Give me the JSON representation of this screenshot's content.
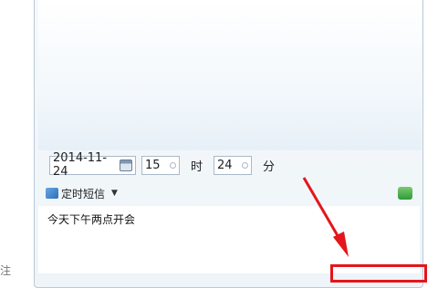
{
  "schedule": {
    "date": "2014-11-24",
    "hour": "15",
    "hour_unit": "时",
    "minute": "24",
    "minute_unit": "分"
  },
  "toolbar": {
    "scheduled_sms_label": "定时短信"
  },
  "message": {
    "text": "今天下午两点开会"
  },
  "side": {
    "partial_char": "注"
  },
  "colors": {
    "annotation_red": "#e3161b"
  }
}
